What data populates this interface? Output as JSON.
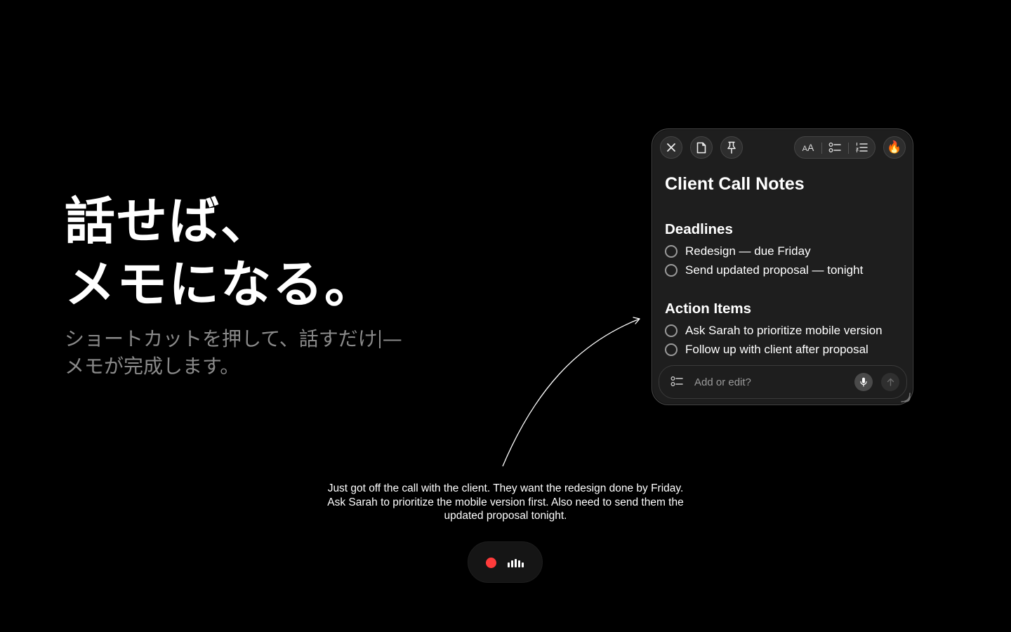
{
  "hero": {
    "title_line1": "話せば、",
    "title_line2": "メモになる。",
    "subtitle_line1_a": "ショートカットを押して、話すだけ",
    "subtitle_line1_b": "—",
    "subtitle_line2": "メモが完成します。"
  },
  "transcript": {
    "text": "Just got off the call with the client. They want the redesign done by Friday. Ask Sarah to prioritize the mobile version first. Also need to send them the updated proposal tonight."
  },
  "recorder": {
    "status": "recording",
    "accent": "#ff3b3b",
    "waveform_levels": [
      0.55,
      0.8,
      1.0,
      0.8,
      0.55
    ]
  },
  "note": {
    "toolbar": {
      "close_icon": "close-icon",
      "file_icon": "document-icon",
      "pin_icon": "pin-icon",
      "text_size_small": "A",
      "text_size_large": "A",
      "checklist_icon": "checklist-icon",
      "numbered_list_icon": "numbered-list-icon",
      "flame_glyph": "🔥"
    },
    "title": "Client Call Notes",
    "sections": [
      {
        "heading": "Deadlines",
        "items": [
          {
            "text": "Redesign — due Friday",
            "checked": false
          },
          {
            "text": "Send updated proposal — tonight",
            "checked": false
          }
        ]
      },
      {
        "heading": "Action Items",
        "items": [
          {
            "text": "Ask Sarah to prioritize mobile version",
            "checked": false
          },
          {
            "text": "Follow up with client after proposal",
            "checked": false
          }
        ]
      }
    ],
    "input": {
      "placeholder": "Add or edit?",
      "value": ""
    }
  }
}
